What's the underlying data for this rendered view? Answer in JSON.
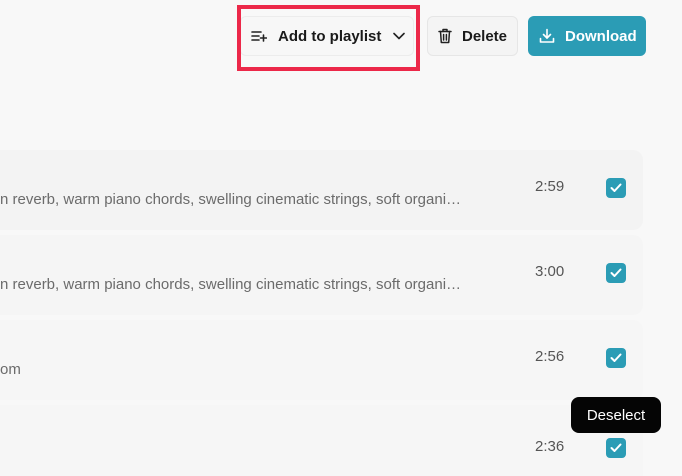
{
  "toolbar": {
    "add_to_playlist_label": "Add to playlist",
    "delete_label": "Delete",
    "download_label": "Download"
  },
  "tracks": [
    {
      "description": "n reverb, warm piano chords, swelling cinematic strings, soft organi…",
      "duration": "2:59",
      "selected": true
    },
    {
      "description": "n reverb, warm piano chords, swelling cinematic strings, soft organi…",
      "duration": "3:00",
      "selected": true
    },
    {
      "description": "om",
      "duration": "2:56",
      "selected": true
    },
    {
      "description": "",
      "duration": "2:36",
      "selected": true
    }
  ],
  "tooltip": {
    "text": "Deselect"
  },
  "colors": {
    "accent": "#2b9cb5",
    "highlight": "#ec2849",
    "tooltip_bg": "#050505"
  },
  "icons": {
    "playlist": "playlist-add-icon",
    "chevron": "chevron-down-icon",
    "delete": "trash-icon",
    "download": "download-icon",
    "check": "check-icon"
  }
}
